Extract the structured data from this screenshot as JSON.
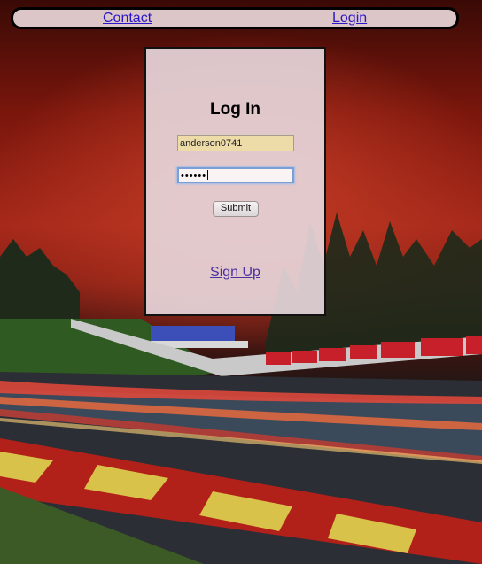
{
  "nav": {
    "contact_label": "Contact",
    "login_label": "Login"
  },
  "login_form": {
    "title": "Log In",
    "username_value": "anderson0741",
    "password_mask": "••••••",
    "submit_label": "Submit",
    "signup_label": "Sign Up"
  },
  "colors": {
    "link": "#2a17c9",
    "card_bg": "#e6d6da",
    "sky": "#a5281a"
  }
}
